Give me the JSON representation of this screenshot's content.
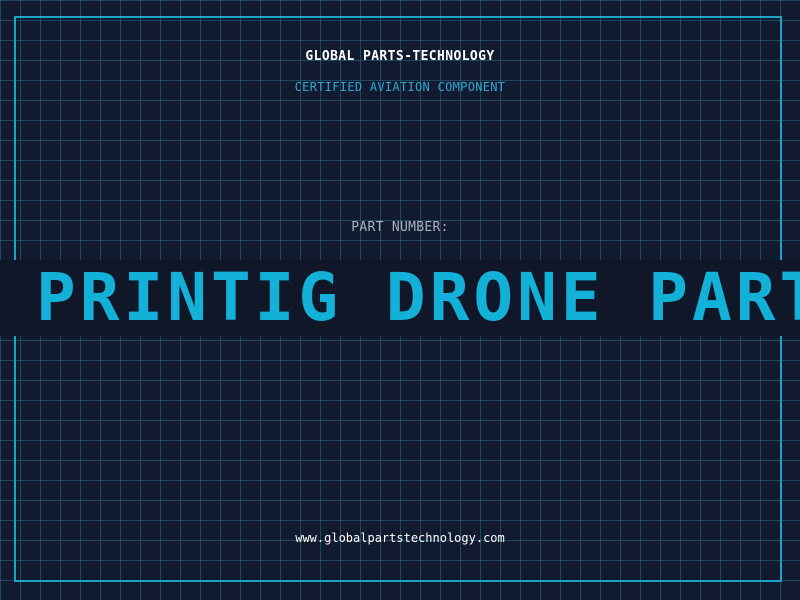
{
  "brand": {
    "name": "GLOBAL PARTS-TECHNOLOGY",
    "tagline": "CERTIFIED AVIATION COMPONENT"
  },
  "part": {
    "label": "PART NUMBER:",
    "value": "PRINTIG DRONE PARTS"
  },
  "footer": {
    "url": "www.globalpartstechnology.com"
  },
  "colors": {
    "background": "#111a2e",
    "grid": "#286e87",
    "frame": "#1ba3c6",
    "accent": "#13b0d8"
  }
}
